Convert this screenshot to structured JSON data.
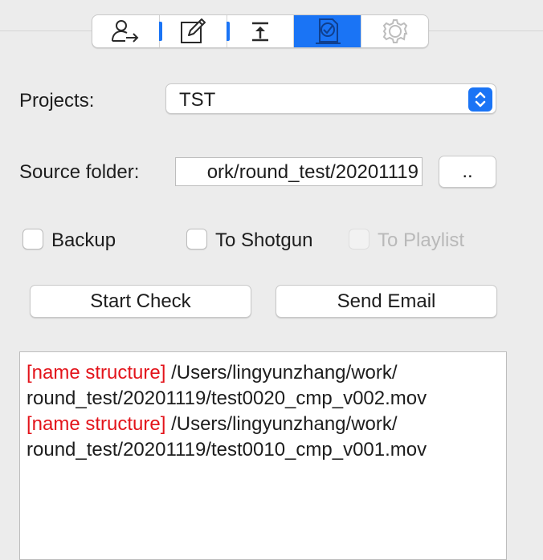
{
  "toolbar": {
    "tabs": [
      {
        "icon": "user-export-icon",
        "selected": false
      },
      {
        "icon": "edit-icon",
        "selected": false
      },
      {
        "icon": "upload-icon",
        "selected": false
      },
      {
        "icon": "check-document-icon",
        "selected": true
      },
      {
        "icon": "gear-icon",
        "selected": false
      }
    ]
  },
  "form": {
    "projects_label": "Projects:",
    "project_value": "TST",
    "source_label": "Source folder:",
    "source_value": "ork/round_test/20201119",
    "browse_label": ".."
  },
  "options": {
    "backup": {
      "label": "Backup",
      "checked": false,
      "enabled": true
    },
    "shotgun": {
      "label": "To Shotgun",
      "checked": false,
      "enabled": true
    },
    "playlist": {
      "label": "To Playlist",
      "checked": false,
      "enabled": false
    }
  },
  "actions": {
    "start_check": "Start Check",
    "send_email": "Send Email"
  },
  "log": {
    "entries": [
      {
        "tag": "[name structure]",
        "path_line1": " /Users/lingyunzhang/work/",
        "path_line2": "round_test/20201119/test0020_cmp_v002.mov"
      },
      {
        "tag": "[name structure]",
        "path_line1": " /Users/lingyunzhang/work/",
        "path_line2": "round_test/20201119/test0010_cmp_v001.mov"
      }
    ]
  },
  "colors": {
    "accent": "#1a74f5",
    "error_tag": "#e3141b",
    "background": "#ececec"
  }
}
